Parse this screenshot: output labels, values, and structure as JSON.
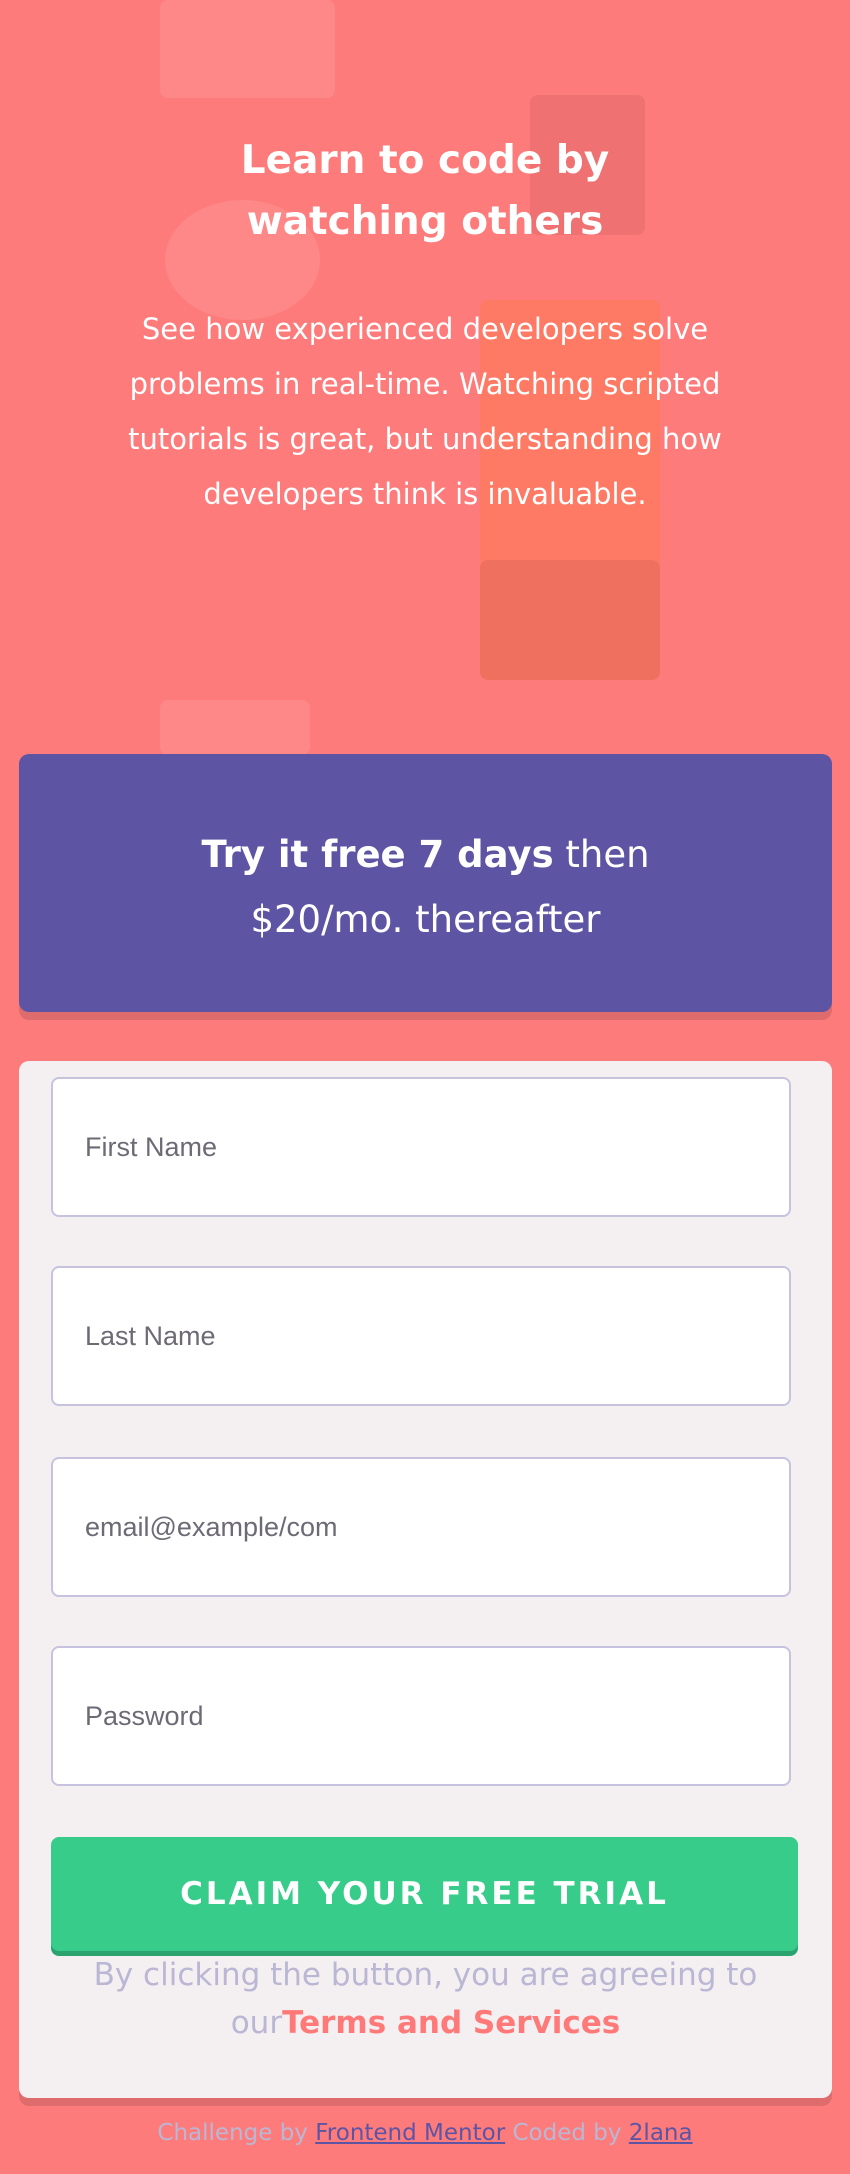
{
  "hero": {
    "title": "Learn to code by watching others",
    "description": "See how experienced developers solve problems in real-time. Watching scripted tutorials is great, but understanding how developers think is invaluable."
  },
  "promo": {
    "bold_text": "Try it free 7 days",
    "line1_tail": " then",
    "line2": "$20/mo. thereafter"
  },
  "form": {
    "first_name_placeholder": "First Name",
    "last_name_placeholder": "Last Name",
    "email_placeholder": "email@example/com",
    "password_placeholder": "Password",
    "submit_label": "CLAIM YOUR FREE TRIAL",
    "terms_prefix": "By clicking the button, you are agreeing to our",
    "terms_link": "Terms and Services"
  },
  "footer": {
    "challenge_prefix": "Challenge by ",
    "challenge_link": "Frontend Mentor",
    "coded_prefix": " Coded by ",
    "coded_link": "2lana"
  },
  "colors": {
    "background": "#fe7b7b",
    "promo": "#5e54a4",
    "cta": "#38cc8b",
    "link": "#ff7979"
  }
}
